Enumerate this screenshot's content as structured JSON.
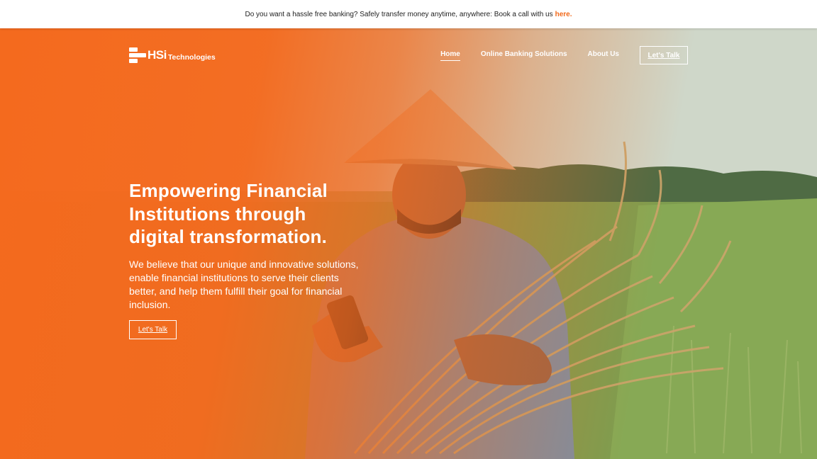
{
  "announcement": {
    "text": "Do you want a hassle free banking? Safely transfer money anytime, anywhere: Book a call with us",
    "link_label": "here."
  },
  "header": {
    "logo_primary": "HSi",
    "logo_secondary": "Technologies",
    "nav": [
      {
        "label": "Home",
        "active": true
      },
      {
        "label": "Online Banking Solutions",
        "active": false
      },
      {
        "label": "About Us",
        "active": false
      }
    ],
    "cta_label": "Let's Talk"
  },
  "hero": {
    "title_line1": "Empowering Financial",
    "title_line2": "Institutions through",
    "title_line3": "digital transformation.",
    "subtitle": "We believe that our unique and innovative solutions, enable financial institutions to serve their clients better, and help them fulfill their goal for financial inclusion.",
    "cta_label": "Let's Talk"
  },
  "colors": {
    "brand_orange": "#f46a1e",
    "link_orange": "#f26a1b",
    "text_white": "#ffffff"
  }
}
